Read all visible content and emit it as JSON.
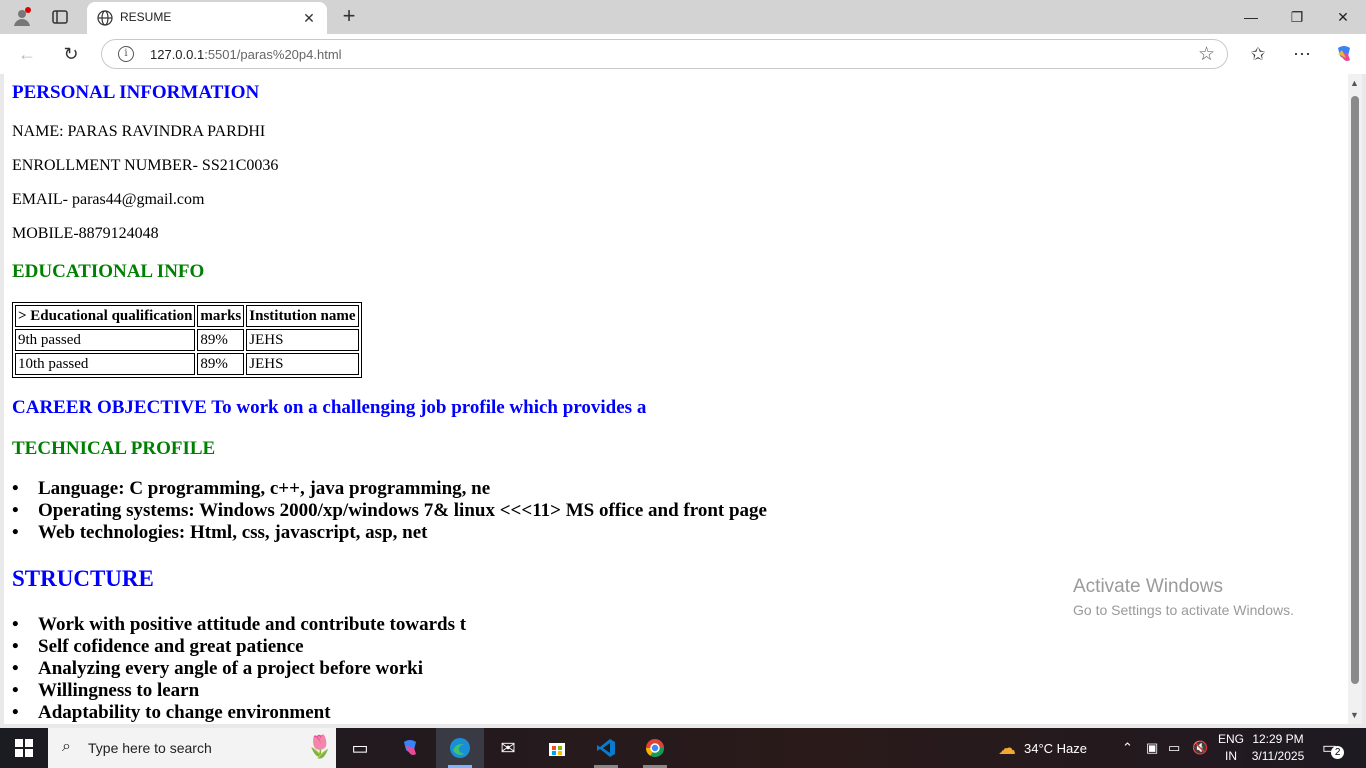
{
  "browser": {
    "tab_title": "RESUME",
    "url_host": "127.0.0.1",
    "url_path": ":5501/paras%20p4.html"
  },
  "page": {
    "personal_heading": "PERSONAL INFORMATION",
    "name_line": "NAME: PARAS RAVINDRA PARDHI",
    "enroll_line": "ENROLLMENT NUMBER- SS21C0036",
    "email_line": "EMAIL- paras44@gmail.com",
    "mobile_line": "MOBILE-8879124048",
    "edu_heading": "EDUCATIONAL INFO",
    "table": {
      "headers": [
        "> Educational qualification",
        "marks",
        "Institution name"
      ],
      "rows": [
        [
          "9th passed",
          "89%",
          "JEHS"
        ],
        [
          "10th passed",
          "89%",
          "JEHS"
        ]
      ]
    },
    "career_line": "CAREER OBJECTIVE To work on a challenging job profile which provides a",
    "tech_heading": "TECHNICAL PROFILE",
    "tech_items": [
      "Language: C programming, c++, java programming, ne",
      "Operating systems: Windows 2000/xp/windows 7& linux <<<11> MS office and front page",
      "Web technologies: Html, css, javascript, asp, net"
    ],
    "structure_heading": "STRUCTURE",
    "structure_items": [
      "Work with positive attitude and contribute towards t",
      "Self cofidence and great patience",
      "Analyzing every angle of a project before worki",
      "Willingness to learn",
      "Adaptability to change environment"
    ]
  },
  "watermark": {
    "line1": "Activate Windows",
    "line2": "Go to Settings to activate Windows."
  },
  "taskbar": {
    "search_placeholder": "Type here to search",
    "weather": "34°C  Haze",
    "lang1": "ENG",
    "lang2": "IN",
    "time": "12:29 PM",
    "date": "3/11/2025",
    "notif_count": "2"
  }
}
